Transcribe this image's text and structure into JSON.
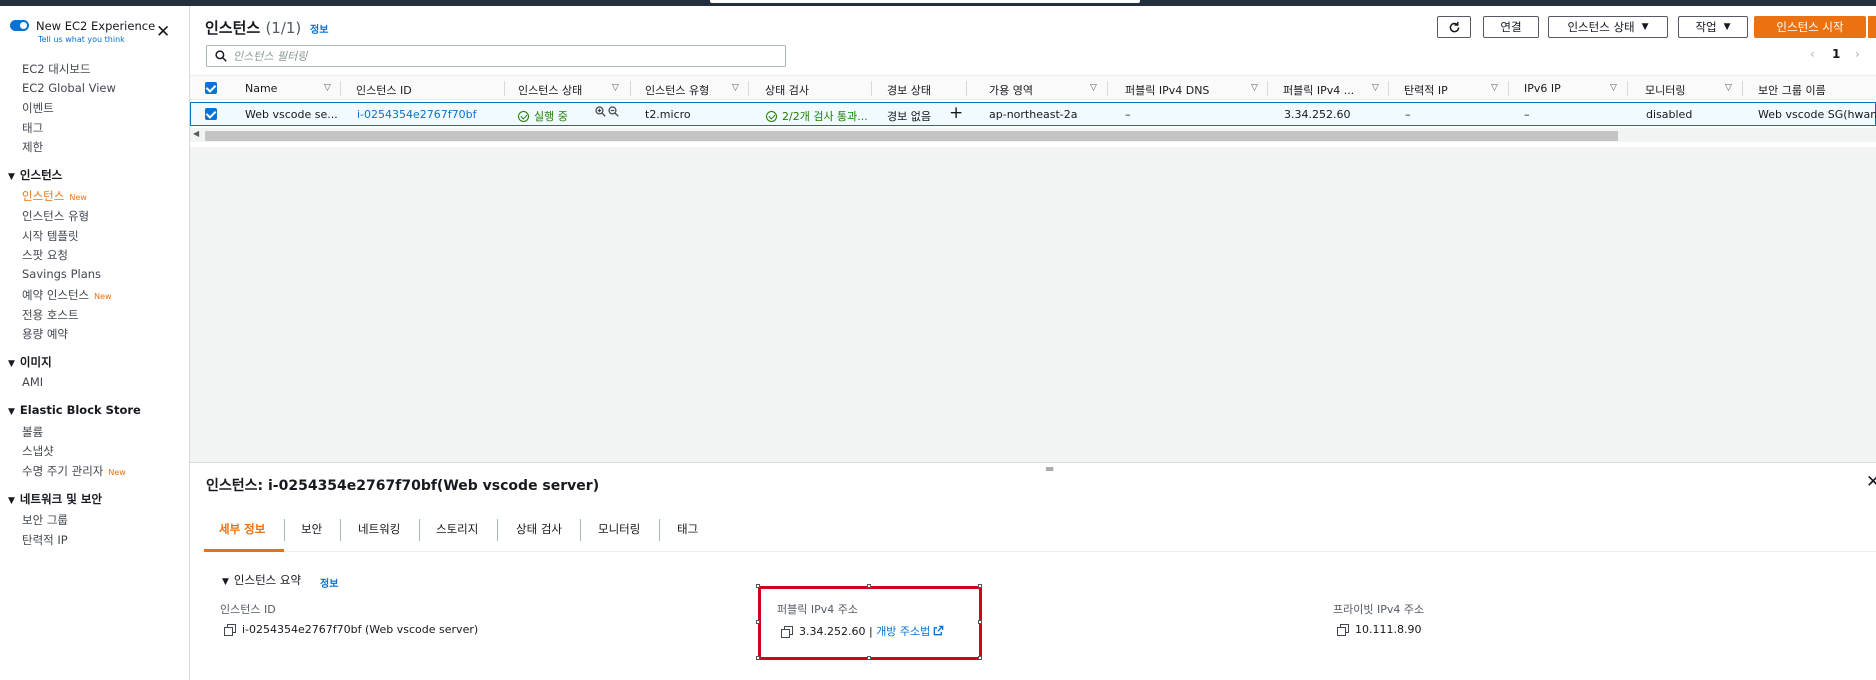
{
  "sidebar": {
    "new_experience_title": "New EC2 Experience",
    "new_experience_sub": "Tell us what you think",
    "items_top": [
      {
        "label": "EC2 대시보드"
      },
      {
        "label": "EC2 Global View"
      },
      {
        "label": "이벤트"
      },
      {
        "label": "태그"
      },
      {
        "label": "제한"
      }
    ],
    "sections": [
      {
        "title": "인스턴스",
        "items": [
          {
            "label": "인스턴스",
            "badge": "New"
          },
          {
            "label": "인스턴스 유형"
          },
          {
            "label": "시작 템플릿"
          },
          {
            "label": "스팟 요청"
          },
          {
            "label": "Savings Plans"
          },
          {
            "label": "예약 인스턴스",
            "badge": "New"
          },
          {
            "label": "전용 호스트"
          },
          {
            "label": "용량 예약"
          }
        ]
      },
      {
        "title": "이미지",
        "items": [
          {
            "label": "AMI"
          }
        ]
      },
      {
        "title": "Elastic Block Store",
        "items": [
          {
            "label": "볼륨"
          },
          {
            "label": "스냅샷"
          },
          {
            "label": "수명 주기 관리자",
            "badge": "New"
          }
        ]
      },
      {
        "title": "네트워크 및 보안",
        "items": [
          {
            "label": "보안 그룹"
          },
          {
            "label": "탄력적 IP"
          }
        ]
      }
    ]
  },
  "header": {
    "title": "인스턴스",
    "count": "(1/1)",
    "info": "정보",
    "buttons": {
      "connect": "연결",
      "instance_state": "인스턴스 상태",
      "actions": "작업",
      "launch": "인스턴스 시작"
    },
    "filter_placeholder": "인스턴스 필터링",
    "page": "1"
  },
  "table": {
    "columns": [
      "Name",
      "인스턴스 ID",
      "인스턴스 상태",
      "인스턴스 유형",
      "상태 검사",
      "경보 상태",
      "가용 영역",
      "퍼블릭 IPv4 DNS",
      "퍼블릭 IPv4 ...",
      "탄력적 IP",
      "IPv6 IP",
      "모니터링",
      "보안 그룹 이름"
    ],
    "row": {
      "name": "Web vscode se...",
      "instance_id": "i-0254354e2767f70bf",
      "state": "실행 중",
      "type": "t2.micro",
      "status_check": "2/2개 검사 통과...",
      "alarm": "경보 없음",
      "az": "ap-northeast-2a",
      "public_dns": "–",
      "public_ip": "3.34.252.60",
      "elastic_ip": "–",
      "ipv6": "–",
      "monitoring": "disabled",
      "security_group": "Web vscode SG(hwan)"
    }
  },
  "detail": {
    "title": "인스턴스: i-0254354e2767f70bf(Web vscode server)",
    "tabs": [
      "세부 정보",
      "보안",
      "네트워킹",
      "스토리지",
      "상태 검사",
      "모니터링",
      "태그"
    ],
    "summary_title": "인스턴스 요약",
    "summary_info": "정보",
    "fields": {
      "instance_id_label": "인스턴스 ID",
      "instance_id_value": "i-0254354e2767f70bf (Web vscode server)",
      "public_ip_label": "퍼블릭 IPv4 주소",
      "public_ip_value": "3.34.252.60",
      "public_ip_sep": " | ",
      "public_ip_link": "개방 주소법",
      "private_ip_label": "프라이빗 IPv4 주소",
      "private_ip_value": "10.111.8.90"
    }
  },
  "colors": {
    "accent": "#ec7211",
    "link": "#0972d3",
    "success": "#1d8102",
    "highlight": "#d0021b"
  }
}
